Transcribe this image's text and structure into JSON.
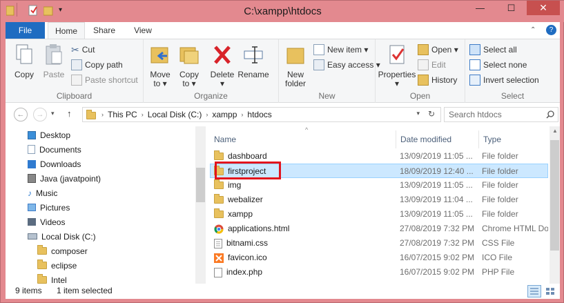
{
  "window": {
    "title": "C:\\xampp\\htdocs",
    "minimize": "—",
    "maximize": "☐",
    "close": "✕"
  },
  "ribbon_tabs": [
    {
      "label": "File"
    },
    {
      "label": "Home"
    },
    {
      "label": "Share"
    },
    {
      "label": "View"
    }
  ],
  "ribbon": {
    "clipboard": {
      "label": "Clipboard",
      "copy": "Copy",
      "paste": "Paste",
      "cut": "Cut",
      "copy_path": "Copy path",
      "paste_shortcut": "Paste shortcut"
    },
    "organize": {
      "label": "Organize",
      "move_to": "Move",
      "move_to_sub": "to ▾",
      "copy_to": "Copy",
      "copy_to_sub": "to ▾",
      "delete": "Delete",
      "delete_sub": "▾",
      "rename": "Rename"
    },
    "new": {
      "label": "New",
      "new_folder": "New",
      "new_folder_sub": "folder",
      "new_item": "New item ▾",
      "easy_access": "Easy access ▾"
    },
    "open": {
      "label": "Open",
      "properties": "Properties",
      "properties_sub": "▾",
      "open": "Open ▾",
      "edit": "Edit",
      "history": "History"
    },
    "select": {
      "label": "Select",
      "select_all": "Select all",
      "select_none": "Select none",
      "invert_selection": "Invert selection"
    }
  },
  "address": {
    "crumbs": [
      "This PC",
      "Local Disk (C:)",
      "xampp",
      "htdocs"
    ],
    "search_placeholder": "Search htdocs"
  },
  "nav_pane": [
    {
      "label": "Desktop"
    },
    {
      "label": "Documents"
    },
    {
      "label": "Downloads"
    },
    {
      "label": "Java (javatpoint)"
    },
    {
      "label": "Music"
    },
    {
      "label": "Pictures"
    },
    {
      "label": "Videos"
    },
    {
      "label": "Local Disk (C:)"
    },
    {
      "label": "composer"
    },
    {
      "label": "eclipse"
    },
    {
      "label": "Intel"
    }
  ],
  "columns": {
    "name": "Name",
    "date": "Date modified",
    "type": "Type"
  },
  "files": [
    {
      "name": "dashboard",
      "date": "13/09/2019 11:05 ...",
      "type": "File folder"
    },
    {
      "name": "firstproject",
      "date": "18/09/2019 12:40 ...",
      "type": "File folder"
    },
    {
      "name": "img",
      "date": "13/09/2019 11:05 ...",
      "type": "File folder"
    },
    {
      "name": "webalizer",
      "date": "13/09/2019 11:04 ...",
      "type": "File folder"
    },
    {
      "name": "xampp",
      "date": "13/09/2019 11:05 ...",
      "type": "File folder"
    },
    {
      "name": "applications.html",
      "date": "27/08/2019 7:32 PM",
      "type": "Chrome HTML Do"
    },
    {
      "name": "bitnami.css",
      "date": "27/08/2019 7:32 PM",
      "type": "CSS File"
    },
    {
      "name": "favicon.ico",
      "date": "16/07/2015 9:02 PM",
      "type": "ICO File"
    },
    {
      "name": "index.php",
      "date": "16/07/2015 9:02 PM",
      "type": "PHP File"
    }
  ],
  "status": {
    "count": "9 items",
    "selected": "1 item selected"
  },
  "colors": {
    "titlebar": "#e3898f",
    "file_tab": "#1f6cc1",
    "selection": "#cce8ff",
    "highlight_box": "#e2131c"
  }
}
